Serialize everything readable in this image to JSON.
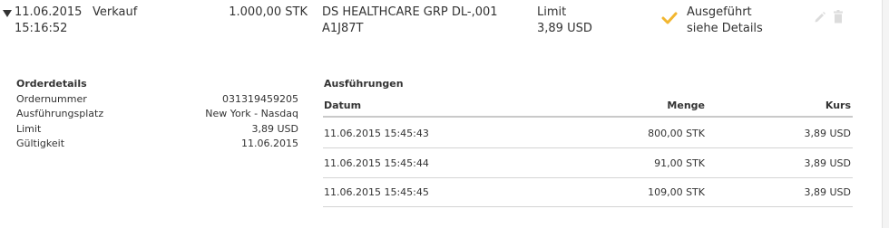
{
  "order": {
    "date": "11.06.2015",
    "time": "15:16:52",
    "type": "Verkauf",
    "quantity": "1.000,00 STK",
    "instrument_name": "DS HEALTHCARE GRP DL-,001",
    "wkn": "A1J87T",
    "order_type": "Limit",
    "limit_price": "3,89 USD",
    "status": "Ausgeführt",
    "status_detail": "siehe Details",
    "status_color": "#f2b630"
  },
  "details": {
    "heading": "Orderdetails",
    "rows": [
      {
        "label": "Ordernummer",
        "value": "031319459205"
      },
      {
        "label": "Ausführungsplatz",
        "value": "New York - Nasdaq"
      },
      {
        "label": "Limit",
        "value": "3,89 USD"
      },
      {
        "label": "Gültigkeit",
        "value": "11.06.2015"
      }
    ]
  },
  "executions": {
    "heading": "Ausführungen",
    "columns": {
      "date": "Datum",
      "quantity": "Menge",
      "price": "Kurs"
    },
    "rows": [
      {
        "date": "11.06.2015 15:45:43",
        "quantity": "800,00 STK",
        "price": "3,89 USD"
      },
      {
        "date": "11.06.2015 15:45:44",
        "quantity": "91,00 STK",
        "price": "3,89 USD"
      },
      {
        "date": "11.06.2015 15:45:45",
        "quantity": "109,00 STK",
        "price": "3,89 USD"
      }
    ]
  },
  "icons": {
    "expand": "triangle-down-icon",
    "status": "checkmark-icon",
    "edit": "pencil-icon",
    "delete": "trash-icon"
  }
}
